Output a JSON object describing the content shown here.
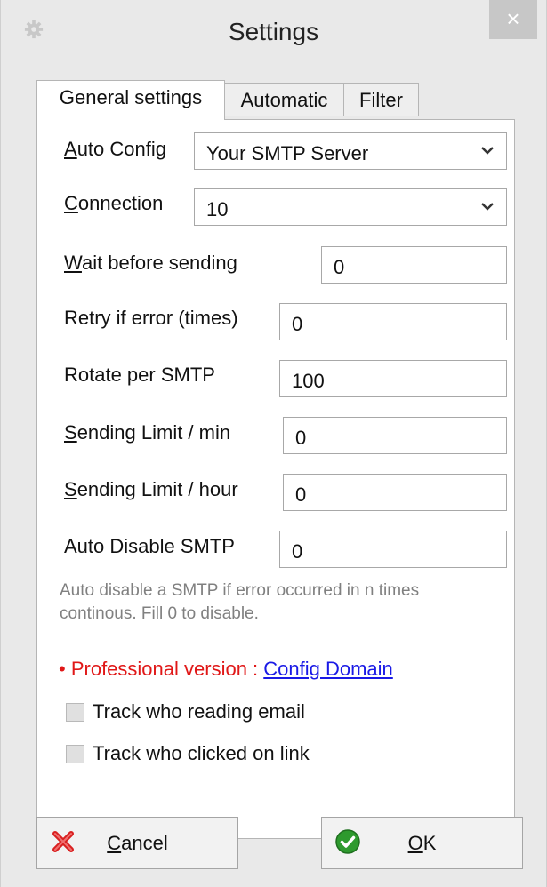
{
  "window": {
    "title": "Settings",
    "close_label": "×"
  },
  "tabs": [
    {
      "label": "General settings",
      "active": true
    },
    {
      "label": "Automatic",
      "active": false
    },
    {
      "label": "Filter",
      "active": false
    }
  ],
  "form": {
    "auto_config": {
      "mnemonic": "A",
      "rest": "uto Config",
      "value": "Your SMTP Server"
    },
    "connection": {
      "mnemonic": "C",
      "rest": "onnection",
      "value": "10"
    },
    "wait_before_sending": {
      "mnemonic": "W",
      "rest": "ait before sending",
      "value": "0"
    },
    "retry_if_error": {
      "label": "Retry if error (times)",
      "value": "0"
    },
    "rotate_per_smtp": {
      "label": "Rotate per SMTP",
      "value": "100"
    },
    "sending_limit_min": {
      "mnemonic": "S",
      "rest": "ending Limit / min",
      "value": "0"
    },
    "sending_limit_hour": {
      "mnemonic": "S",
      "rest": "ending Limit / hour",
      "value": "0"
    },
    "auto_disable_smtp": {
      "label": "Auto Disable SMTP",
      "value": "0"
    }
  },
  "hint": {
    "line1": "Auto disable a SMTP if error occurred in n times",
    "line2": "continous. Fill 0 to disable."
  },
  "professional": {
    "bullet": "•",
    "label": "Professional version : ",
    "link": "Config Domain"
  },
  "tracking": {
    "track_reading": {
      "label": "Track who reading email",
      "checked": false
    },
    "track_clicked": {
      "label": "Track who clicked on link",
      "checked": false
    }
  },
  "buttons": {
    "cancel": {
      "mnemonic": "C",
      "rest": "ancel",
      "icon": "red-x-icon"
    },
    "ok": {
      "mnemonic": "O",
      "rest": "K",
      "icon": "green-check-icon"
    }
  },
  "colors": {
    "window_bg": "#e9e9e9",
    "close_button_bg": "#c7c7c7",
    "professional_red": "#e01717",
    "link_blue": "#1a1ae6",
    "hint_gray": "#808080"
  }
}
